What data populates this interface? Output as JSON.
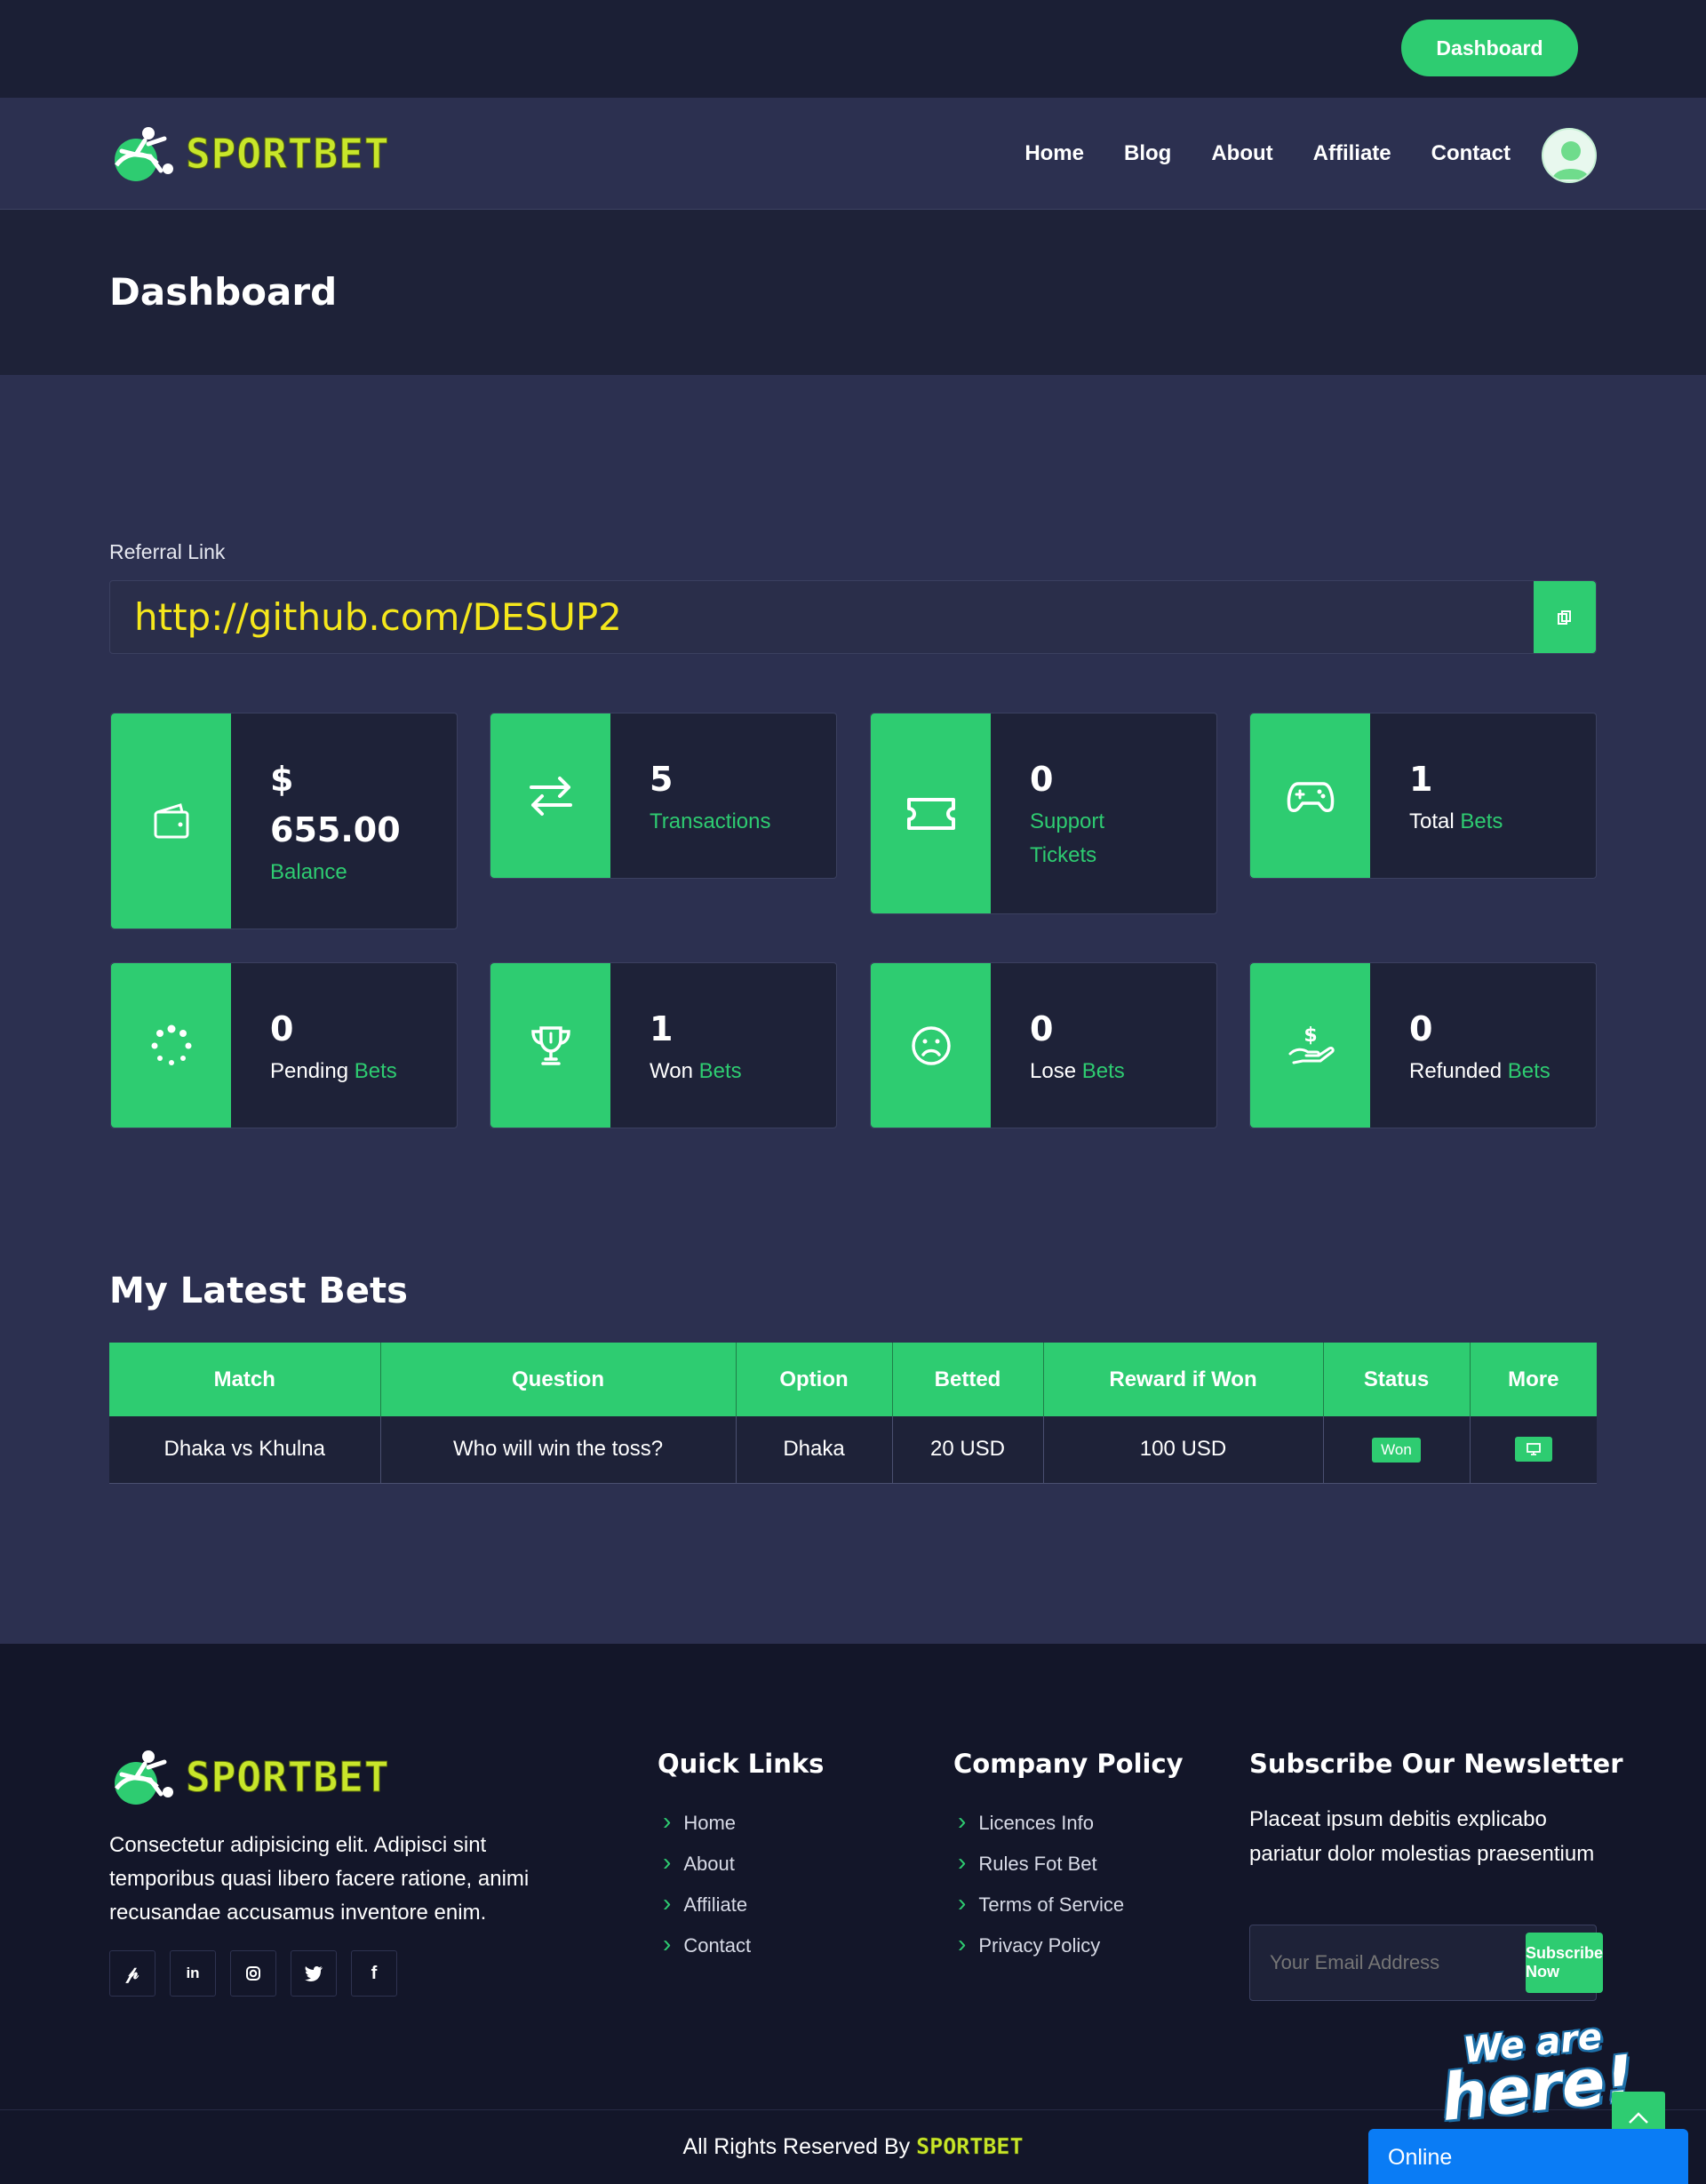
{
  "topbar": {
    "dashboard_button": "Dashboard"
  },
  "brand": {
    "name": "SPORTBET"
  },
  "nav": {
    "items": [
      "Home",
      "Blog",
      "About",
      "Affiliate",
      "Contact"
    ]
  },
  "page": {
    "title": "Dashboard"
  },
  "referral": {
    "label": "Referral Link",
    "value": "http://github.com/DESUP2"
  },
  "stats": [
    {
      "icon": "wallet-icon",
      "value_line1": "$",
      "value_line2": "655.00",
      "label_plain": "",
      "label_green": "Balance"
    },
    {
      "icon": "transfer-arrows-icon",
      "value": "5",
      "label_plain": "",
      "label_green": "Transactions"
    },
    {
      "icon": "ticket-icon",
      "value": "0",
      "label_plain": "",
      "label_green_line1": "Support",
      "label_green_line2": "Tickets"
    },
    {
      "icon": "gamepad-icon",
      "value": "1",
      "label_plain": "Total",
      "label_green": "Bets"
    },
    {
      "icon": "spinner-icon",
      "value": "0",
      "label_plain": "Pending",
      "label_green": "Bets"
    },
    {
      "icon": "trophy-icon",
      "value": "1",
      "label_plain": "Won",
      "label_green": "Bets"
    },
    {
      "icon": "sad-face-icon",
      "value": "0",
      "label_plain": "Lose",
      "label_green": "Bets"
    },
    {
      "icon": "hand-dollar-icon",
      "value": "0",
      "label_plain": "Refunded",
      "label_green": "Bets"
    }
  ],
  "latest_bets": {
    "title": "My Latest Bets",
    "columns": [
      "Match",
      "Question",
      "Option",
      "Betted",
      "Reward if Won",
      "Status",
      "More"
    ],
    "rows": [
      {
        "match": "Dhaka vs Khulna",
        "question": "Who will win the toss?",
        "option": "Dhaka",
        "betted": "20 USD",
        "reward": "100 USD",
        "status": "Won"
      }
    ]
  },
  "footer": {
    "about": "Consectetur adipisicing elit. Adipisci sint temporibus quasi libero facere ratione, animi recusandae accusamus inventore enim.",
    "social": [
      "pinterest-icon",
      "linkedin-icon",
      "instagram-icon",
      "twitter-icon",
      "facebook-icon"
    ],
    "quick_links": {
      "title": "Quick Links",
      "items": [
        "Home",
        "About",
        "Affiliate",
        "Contact"
      ]
    },
    "company_policy": {
      "title": "Company Policy",
      "items": [
        "Licences Info",
        "Rules Fot Bet",
        "Terms of Service",
        "Privacy Policy"
      ]
    },
    "newsletter": {
      "title": "Subscribe Our Newsletter",
      "text": "Placeat ipsum debitis explicabo pariatur dolor molestias praesentium",
      "placeholder": "Your Email Address",
      "button": "Subscribe Now"
    },
    "copyright_prefix": "All Rights Reserved By",
    "copyright_brand": "SPORTBET"
  },
  "chat": {
    "badge_line1": "We are",
    "badge_line2": "here!",
    "status": "Online"
  },
  "colors": {
    "accent": "#2ecc71",
    "brand_yellow": "#c8e62a",
    "bg": "#2c3050",
    "topbar": "#1b1f35",
    "footer": "#131629",
    "referral_text": "#f5e71c",
    "chat_blue": "#0a7cf5"
  }
}
